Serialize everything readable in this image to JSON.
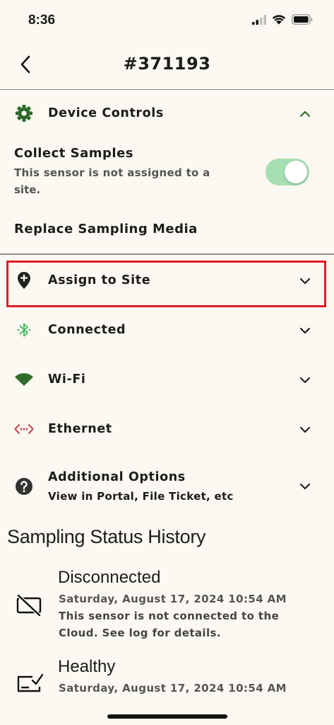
{
  "status_bar": {
    "time": "8:36"
  },
  "header": {
    "title": "#371193"
  },
  "device_controls": {
    "label": "Device Controls",
    "collect_samples": {
      "label": "Collect Samples",
      "description_line1": "This sensor is not assigned to a",
      "description_line2": "site.",
      "enabled": true
    },
    "replace_media_label": "Replace Sampling Media"
  },
  "sections": {
    "assign": {
      "label": "Assign to Site"
    },
    "connected": {
      "label": "Connected"
    },
    "wifi": {
      "label": "Wi-Fi"
    },
    "ethernet": {
      "label": "Ethernet"
    },
    "additional": {
      "label": "Additional Options",
      "subtitle": "View in Portal, File Ticket, etc"
    }
  },
  "history": {
    "title": "Sampling Status History",
    "entries": [
      {
        "status": "Disconnected",
        "timestamp": "Saturday, August 17, 2024 10:54 AM",
        "message_line1": "This sensor is not connected to the",
        "message_line2": "Cloud. See log for details."
      },
      {
        "status": "Healthy",
        "timestamp": "Saturday, August 17, 2024 10:54 AM"
      }
    ]
  },
  "colors": {
    "background": "#fbf9f1",
    "accent_green": "#2f6b2a",
    "toggle_on": "#a6dfb1",
    "bluetooth_green": "#4fbf6a",
    "ethernet_red": "#c23b3b",
    "highlight_red": "#e01d25"
  },
  "icons": {
    "gear": "gear-icon",
    "location": "location-plus-icon",
    "bluetooth": "bluetooth-icon",
    "wifi": "wifi-icon",
    "ethernet": "ethernet-icon",
    "help": "help-circle-icon"
  }
}
